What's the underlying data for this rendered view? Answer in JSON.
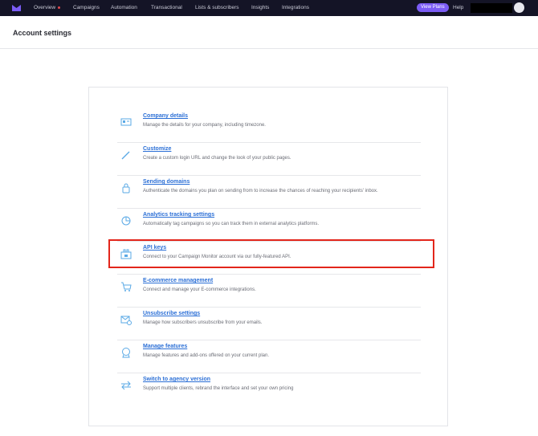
{
  "nav": {
    "items": [
      "Overview",
      "Campaigns",
      "Automation",
      "Transactional",
      "Lists & subscribers",
      "Insights",
      "Integrations"
    ],
    "view_plans": "View Plans",
    "help": "Help",
    "accent": "#7b5cf5"
  },
  "header": {
    "title": "Account settings"
  },
  "settings": [
    {
      "label": "Company details",
      "desc": "Manage the details for your company, including timezone.",
      "icon": "id-card-icon"
    },
    {
      "label": "Customize",
      "desc": "Create a custom login URL and change the look of your public pages.",
      "icon": "pen-icon"
    },
    {
      "label": "Sending domains",
      "desc": "Authenticate the domains you plan on sending from to increase the chances of reaching your recipients' inbox.",
      "icon": "lock-icon"
    },
    {
      "label": "Analytics tracking settings",
      "desc": "Automatically tag campaigns so you can track them in external analytics platforms.",
      "icon": "pie-chart-icon"
    },
    {
      "label": "API keys",
      "desc": "Connect to your Campaign Monitor account via our fully-featured API.",
      "icon": "api-box-icon"
    },
    {
      "label": "E-commerce management",
      "desc": "Connect and manage your E-commerce integrations.",
      "icon": "cart-icon"
    },
    {
      "label": "Unsubscribe settings",
      "desc": "Manage how subscribers unsubscribe from your emails.",
      "icon": "envelope-x-icon"
    },
    {
      "label": "Manage features",
      "desc": "Manage features and add-ons offered on your current plan.",
      "icon": "badge-icon"
    },
    {
      "label": "Switch to agency version",
      "desc": "Support multiple clients, rebrand the interface and set your own pricing",
      "icon": "switch-arrows-icon"
    }
  ]
}
